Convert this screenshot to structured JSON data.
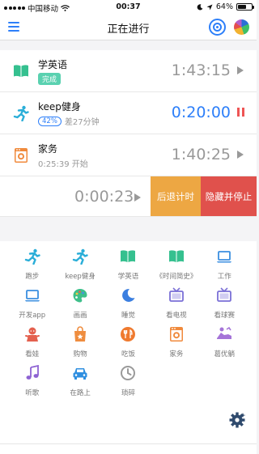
{
  "status_bar": {
    "carrier": "中国移动",
    "time": "00:37",
    "battery": "64%",
    "battery_level": 0.64
  },
  "nav": {
    "title": "正在进行",
    "menu_icon": "menu-icon",
    "target_icon": "target-icon",
    "pie_icon": "pie-chart-icon"
  },
  "tasks": [
    {
      "name": "学英语",
      "badge": "完成",
      "time": "1:43:15",
      "state": "stopped",
      "icon": "book-icon",
      "color": "#35c08f"
    },
    {
      "name": "keep健身",
      "percent": "42%",
      "remaining": "差27分钟",
      "time": "0:20:00",
      "state": "running",
      "icon": "running-icon",
      "color": "#2aaed8"
    },
    {
      "name": "家务",
      "start": "0:25:39 开始",
      "time": "1:40:25",
      "state": "stopped",
      "icon": "washing-machine-icon",
      "color": "#f08a3c"
    }
  ],
  "swipe_row": {
    "time": "0:00:23",
    "back_label": "后退计时",
    "hide_label": "隐藏并停止"
  },
  "activities": [
    {
      "label": "跑步",
      "icon": "running-icon",
      "color": "#2aaed8"
    },
    {
      "label": "keep健身",
      "icon": "running-icon",
      "color": "#2aaed8"
    },
    {
      "label": "学英语",
      "icon": "book-icon",
      "color": "#35c08f"
    },
    {
      "label": "《时间简史》",
      "icon": "book-icon",
      "color": "#35c08f"
    },
    {
      "label": "工作",
      "icon": "laptop-icon",
      "color": "#3b8fe0"
    },
    {
      "label": "开发app",
      "icon": "laptop-icon",
      "color": "#3b8fe0"
    },
    {
      "label": "画画",
      "icon": "palette-icon",
      "color": "#3ebf8a"
    },
    {
      "label": "睡觉",
      "icon": "moon-icon",
      "color": "#3b7fe0"
    },
    {
      "label": "看电视",
      "icon": "tv-icon",
      "color": "#7a6fd6"
    },
    {
      "label": "看球赛",
      "icon": "tv-icon",
      "color": "#7a6fd6"
    },
    {
      "label": "看娃",
      "icon": "baby-icon",
      "color": "#e4604e"
    },
    {
      "label": "购物",
      "icon": "shopping-bag-icon",
      "color": "#ef8d3f"
    },
    {
      "label": "吃饭",
      "icon": "dining-icon",
      "color": "#ef7a2f"
    },
    {
      "label": "家务",
      "icon": "washing-machine-icon",
      "color": "#f08a3c"
    },
    {
      "label": "葛优躺",
      "icon": "lounging-icon",
      "color": "#a574d8"
    },
    {
      "label": "听歌",
      "icon": "music-note-icon",
      "color": "#8e63d3"
    },
    {
      "label": "在路上",
      "icon": "car-icon",
      "color": "#2f8fe0"
    },
    {
      "label": "琐碎",
      "icon": "clock-icon",
      "color": "#9a9a9a"
    }
  ],
  "settings_icon": "gear-icon"
}
